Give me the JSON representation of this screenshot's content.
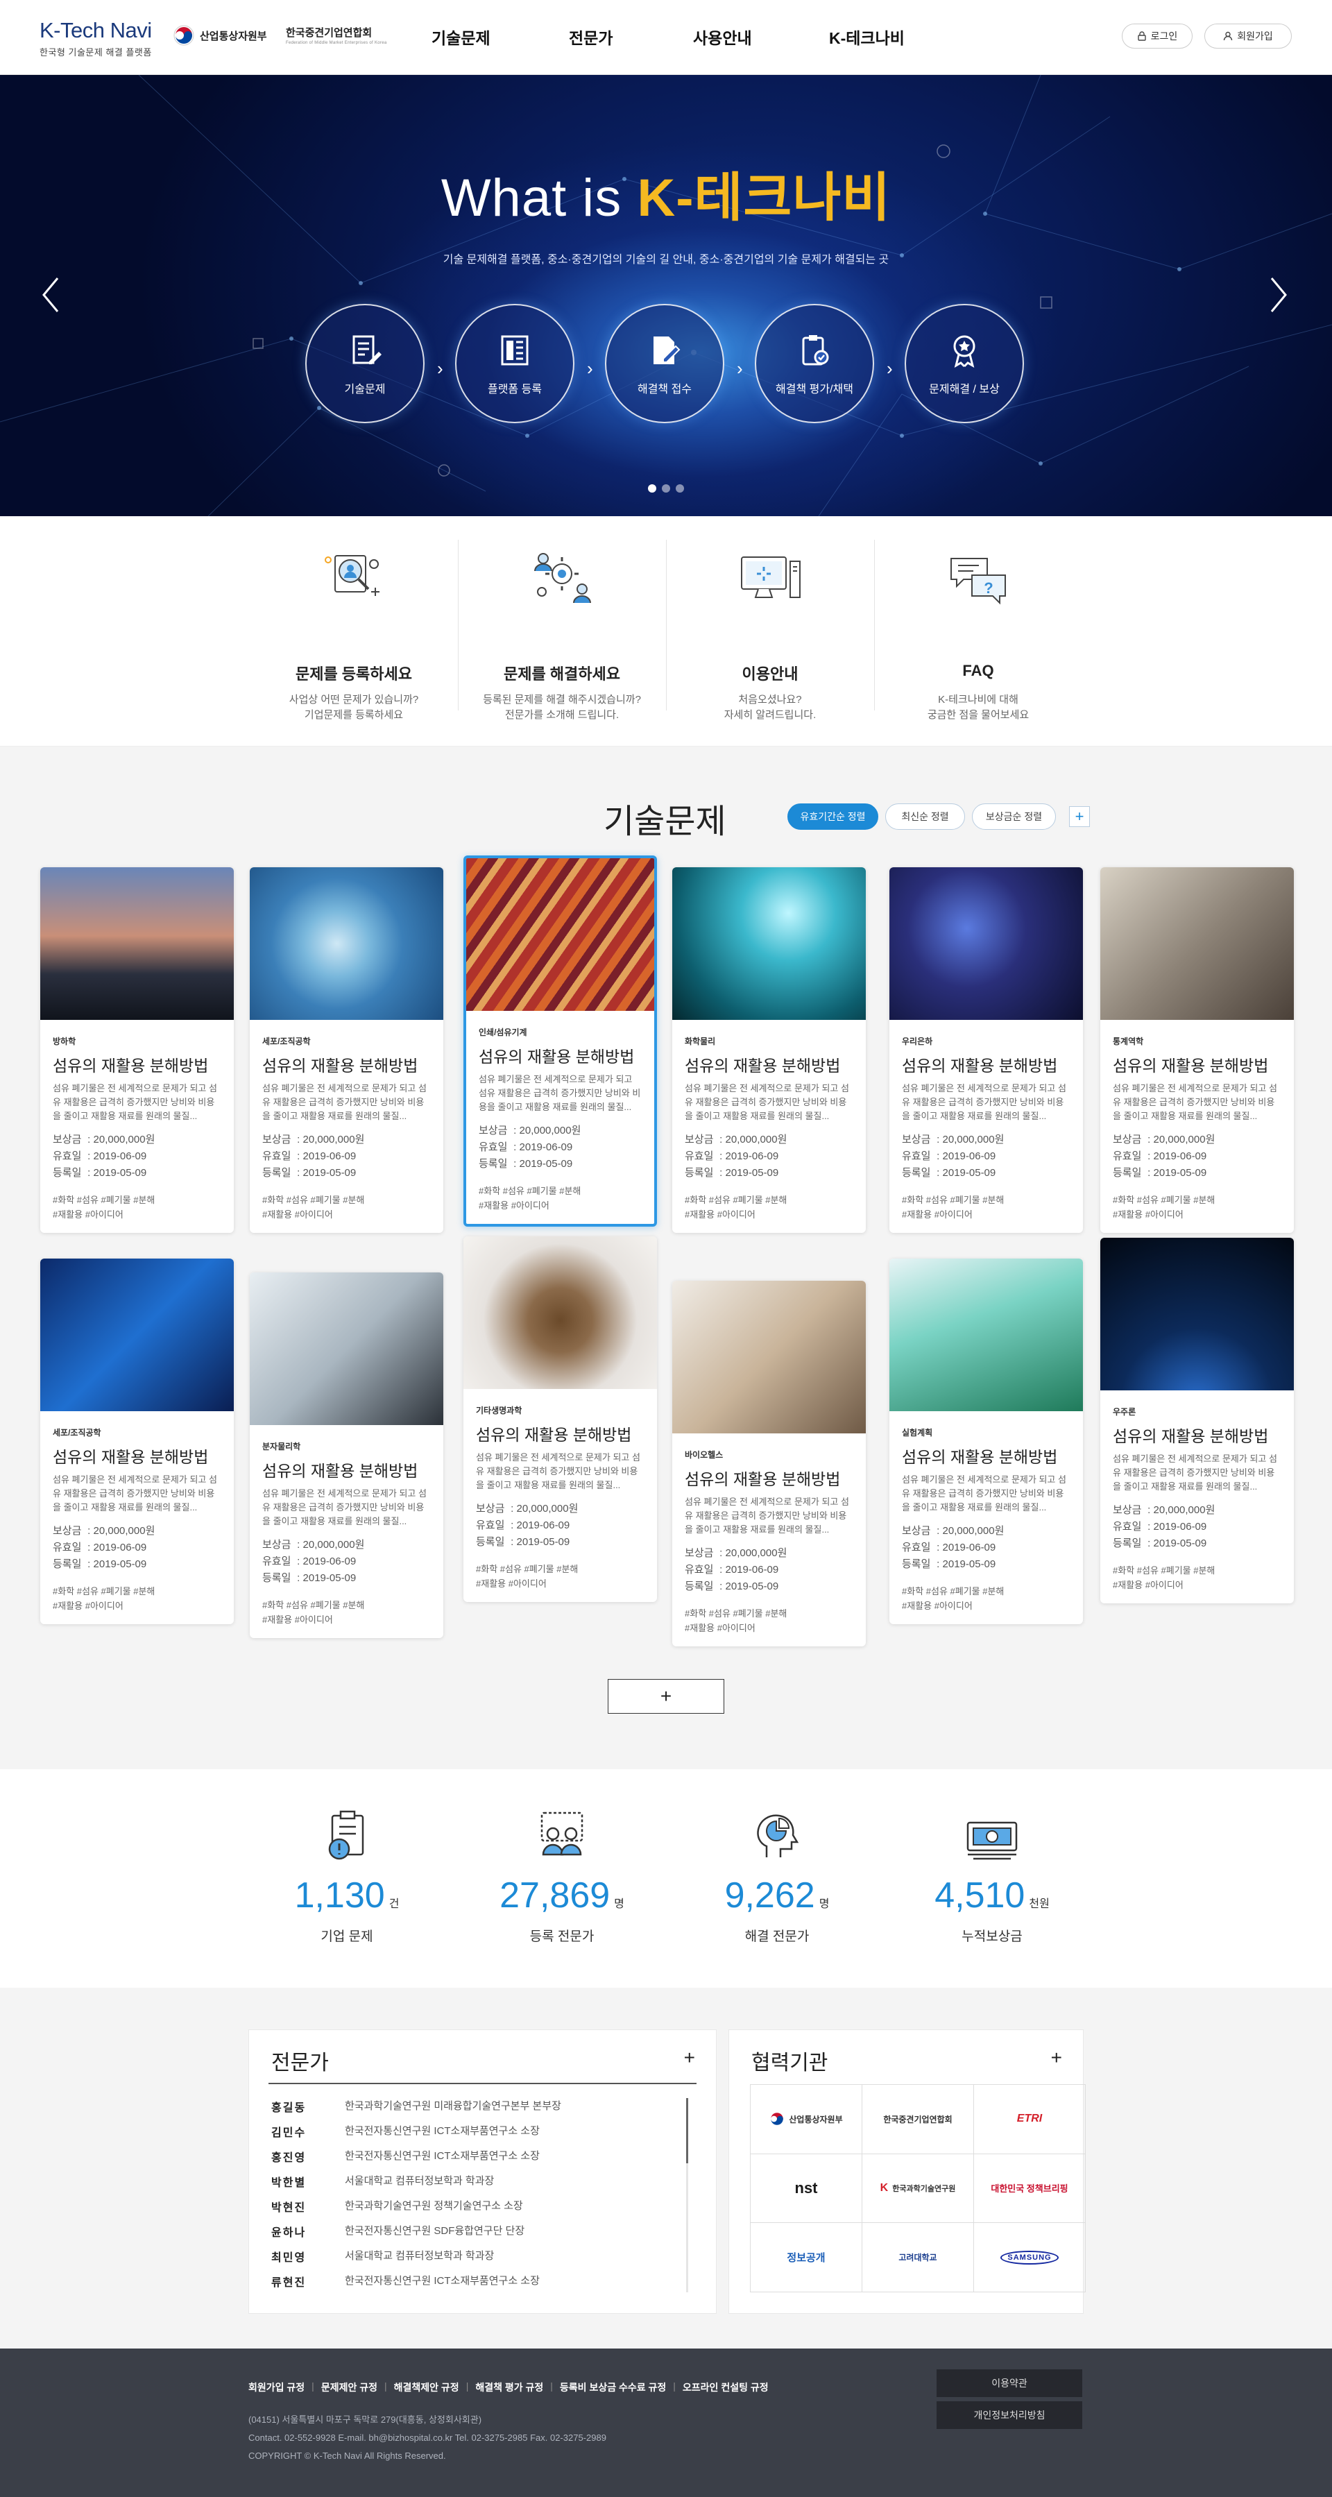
{
  "header": {
    "logo_title": "K-Tech Navi",
    "logo_sub": "한국형 기술문제 해결 플랫폼",
    "partner1": "산업통상자원부",
    "partner2": "한국중견기업연합회",
    "partner2_sub": "Federation of Middle Market Enterprises of Korea",
    "nav": [
      "기술문제",
      "전문가",
      "사용안내",
      "K-테크나비"
    ],
    "login": "로그인",
    "join": "회원가입"
  },
  "hero": {
    "title_prefix": "What is ",
    "title_highlight": "K-테크나비",
    "subtitle": "기술 문제해결 플랫폼, 중소·중견기업의 기술의 길 안내, 중소·중견기업의 기술 문제가 해결되는 곳",
    "steps": [
      {
        "label": "기술문제",
        "icon": "document-pen-icon"
      },
      {
        "label": "플랫폼 등록",
        "icon": "list-document-icon"
      },
      {
        "label": "해결책 접수",
        "icon": "edit-document-icon"
      },
      {
        "label": "해결책 평가/채택",
        "icon": "clipboard-check-icon"
      },
      {
        "label": "문제해결 / 보상",
        "icon": "award-badge-icon"
      }
    ],
    "slide_count": 3,
    "active_slide": 1
  },
  "quick": [
    {
      "title": "문제를 등록하세요",
      "desc1": "사업상 어떤 문제가 있습니까?",
      "desc2": "기업문제를 등록하세요",
      "icon": "user-search-icon"
    },
    {
      "title": "문제를 해결하세요",
      "desc1": "등록된 문제를 해결 해주시겠습니까?",
      "desc2": "전문가를 소개해 드립니다.",
      "icon": "team-gear-icon"
    },
    {
      "title": "이용안내",
      "desc1": "처음오셨나요?",
      "desc2": "자세히 알려드립니다.",
      "icon": "computer-icon"
    },
    {
      "title": "FAQ",
      "desc1": "K-테크나비에 대해",
      "desc2": "궁금한 점을 물어보세요",
      "icon": "chat-question-icon"
    }
  ],
  "problems": {
    "title": "기술문제",
    "sorts": [
      "유효기간순 정렬",
      "최신순 정렬",
      "보상금순 정렬"
    ],
    "add": "+",
    "labels": {
      "reward": "보상금",
      "valid": "유효일",
      "reg": "등록일"
    },
    "cards": [
      {
        "cat": "방하학",
        "title": "섬유의 재활용 분해방법",
        "desc": "섬유 폐기물은 전 세계적으로 문제가 되고 섬유 재활용은 급격히 증가했지만 낭비와 비용을 줄이고 재활용 재료를 원래의 물질...",
        "reward": "20,000,000원",
        "valid": "2019-06-09",
        "reg": "2019-05-09",
        "tags1": "#화학 #섬유 #폐기물 #분해",
        "tags2": "#재활용 #아이디어"
      },
      {
        "cat": "세포/조직공학",
        "title": "섬유의 재활용 분해방법",
        "desc": "섬유 폐기물은 전 세계적으로 문제가 되고 섬유 재활용은 급격히 증가했지만 낭비와 비용을 줄이고 재활용 재료를 원래의 물질...",
        "reward": "20,000,000원",
        "valid": "2019-06-09",
        "reg": "2019-05-09",
        "tags1": "#화학 #섬유 #폐기물 #분해",
        "tags2": "#재활용 #아이디어"
      },
      {
        "cat": "인쇄/섬유기계",
        "title": "섬유의 재활용 분해방법",
        "desc": "섬유 폐기물은 전 세계적으로 문제가 되고 섬유 재활용은 급격히 증가했지만 낭비와 비용을 줄이고 재활용 재료를 원래의 물질...",
        "reward": "20,000,000원",
        "valid": "2019-06-09",
        "reg": "2019-05-09",
        "tags1": "#화학 #섬유 #폐기물 #분해",
        "tags2": "#재활용 #아이디어"
      },
      {
        "cat": "화학물리",
        "title": "섬유의 재활용 분해방법",
        "desc": "섬유 폐기물은 전 세계적으로 문제가 되고 섬유 재활용은 급격히 증가했지만 낭비와 비용을 줄이고 재활용 재료를 원래의 물질...",
        "reward": "20,000,000원",
        "valid": "2019-06-09",
        "reg": "2019-05-09",
        "tags1": "#화학 #섬유 #폐기물 #분해",
        "tags2": "#재활용 #아이디어"
      },
      {
        "cat": "우리은하",
        "title": "섬유의 재활용 분해방법",
        "desc": "섬유 폐기물은 전 세계적으로 문제가 되고 섬유 재활용은 급격히 증가했지만 낭비와 비용을 줄이고 재활용 재료를 원래의 물질...",
        "reward": "20,000,000원",
        "valid": "2019-06-09",
        "reg": "2019-05-09",
        "tags1": "#화학 #섬유 #폐기물 #분해",
        "tags2": "#재활용 #아이디어"
      },
      {
        "cat": "통계역학",
        "title": "섬유의 재활용 분해방법",
        "desc": "섬유 폐기물은 전 세계적으로 문제가 되고 섬유 재활용은 급격히 증가했지만 낭비와 비용을 줄이고 재활용 재료를 원래의 물질...",
        "reward": "20,000,000원",
        "valid": "2019-06-09",
        "reg": "2019-05-09",
        "tags1": "#화학 #섬유 #폐기물 #분해",
        "tags2": "#재활용 #아이디어"
      },
      {
        "cat": "세포/조직공학",
        "title": "섬유의 재활용 분해방법",
        "desc": "섬유 폐기물은 전 세계적으로 문제가 되고 섬유 재활용은 급격히 증가했지만 낭비와 비용을 줄이고 재활용 재료를 원래의 물질...",
        "reward": "20,000,000원",
        "valid": "2019-06-09",
        "reg": "2019-05-09",
        "tags1": "#화학 #섬유 #폐기물 #분해",
        "tags2": "#재활용 #아이디어"
      },
      {
        "cat": "분자물리학",
        "title": "섬유의 재활용 분해방법",
        "desc": "섬유 폐기물은 전 세계적으로 문제가 되고 섬유 재활용은 급격히 증가했지만 낭비와 비용을 줄이고 재활용 재료를 원래의 물질...",
        "reward": "20,000,000원",
        "valid": "2019-06-09",
        "reg": "2019-05-09",
        "tags1": "#화학 #섬유 #폐기물 #분해",
        "tags2": "#재활용 #아이디어"
      },
      {
        "cat": "기타생명과학",
        "title": "섬유의 재활용 분해방법",
        "desc": "섬유 폐기물은 전 세계적으로 문제가 되고 섬유 재활용은 급격히 증가했지만 낭비와 비용을 줄이고 재활용 재료를 원래의 물질...",
        "reward": "20,000,000원",
        "valid": "2019-06-09",
        "reg": "2019-05-09",
        "tags1": "#화학 #섬유 #폐기물 #분해",
        "tags2": "#재활용 #아이디어"
      },
      {
        "cat": "바이오헬스",
        "title": "섬유의 재활용 분해방법",
        "desc": "섬유 폐기물은 전 세계적으로 문제가 되고 섬유 재활용은 급격히 증가했지만 낭비와 비용을 줄이고 재활용 재료를 원래의 물질...",
        "reward": "20,000,000원",
        "valid": "2019-06-09",
        "reg": "2019-05-09",
        "tags1": "#화학 #섬유 #폐기물 #분해",
        "tags2": "#재활용 #아이디어"
      },
      {
        "cat": "실험계획",
        "title": "섬유의 재활용 분해방법",
        "desc": "섬유 폐기물은 전 세계적으로 문제가 되고 섬유 재활용은 급격히 증가했지만 낭비와 비용을 줄이고 재활용 재료를 원래의 물질...",
        "reward": "20,000,000원",
        "valid": "2019-06-09",
        "reg": "2019-05-09",
        "tags1": "#화학 #섬유 #폐기물 #분해",
        "tags2": "#재활용 #아이디어"
      },
      {
        "cat": "우주론",
        "title": "섬유의 재활용 분해방법",
        "desc": "섬유 폐기물은 전 세계적으로 문제가 되고 섬유 재활용은 급격히 증가했지만 낭비와 비용을 줄이고 재활용 재료를 원래의 물질...",
        "reward": "20,000,000원",
        "valid": "2019-06-09",
        "reg": "2019-05-09",
        "tags1": "#화학 #섬유 #폐기물 #분해",
        "tags2": "#재활용 #아이디어"
      }
    ],
    "more": "+"
  },
  "stats": [
    {
      "num": "1,130",
      "unit": "건",
      "label": "기업 문제",
      "icon": "clipboard-alert-icon"
    },
    {
      "num": "27,869",
      "unit": "명",
      "label": "등록 전문가",
      "icon": "experts-icon"
    },
    {
      "num": "9,262",
      "unit": "명",
      "label": "해결 전문가",
      "icon": "head-chart-icon"
    },
    {
      "num": "4,510",
      "unit": "천원",
      "label": "누적보상금",
      "icon": "money-icon"
    }
  ],
  "experts": {
    "title": "전문가",
    "plus": "+",
    "rows": [
      {
        "name": "홍길동",
        "org": "한국과학기술연구원 미래융합기술연구본부 본부장"
      },
      {
        "name": "김민수",
        "org": "한국전자통신연구원 ICT소재부품연구소 소장"
      },
      {
        "name": "홍진영",
        "org": "한국전자통신연구원 ICT소재부품연구소 소장"
      },
      {
        "name": "박한별",
        "org": "서울대학교 컴퓨터정보학과 학과장"
      },
      {
        "name": "박현진",
        "org": "한국과학기술연구원 정책기술연구소 소장"
      },
      {
        "name": "윤하나",
        "org": "한국전자통신연구원 SDF융합연구단 단장"
      },
      {
        "name": "최민영",
        "org": "서울대학교 컴퓨터정보학과 학과장"
      },
      {
        "name": "류현진",
        "org": "한국전자통신연구원 ICT소재부품연구소 소장"
      }
    ]
  },
  "partners": {
    "title": "협력기관",
    "plus": "+",
    "items": [
      "산업통상자원부",
      "한국중견기업연합회",
      "ETRI",
      "nst",
      "한국과학기술연구원",
      "대한민국 정책브리핑",
      "정보공개",
      "고려대학교",
      "SAMSUNG"
    ]
  },
  "footer": {
    "links": [
      "회원가입 규정",
      "문제제안 규정",
      "해결책제안 규정",
      "해결책 평가 규정",
      "등록비 보상금 수수료 규정",
      "오프라인 컨설팅 규정"
    ],
    "address": "(04151) 서울특별시 마포구 독막로 279(대흥동, 상정회사회관)",
    "contact": "Contact. 02-552-9928   E-mail. bh@bizhospital.co.kr   Tel. 02-3275-2985   Fax. 02-3275-2989",
    "copyright": "COPYRIGHT © K-Tech Navi All Rights Reserved.",
    "btn_terms": "이용약관",
    "btn_privacy": "개인정보처리방침"
  }
}
